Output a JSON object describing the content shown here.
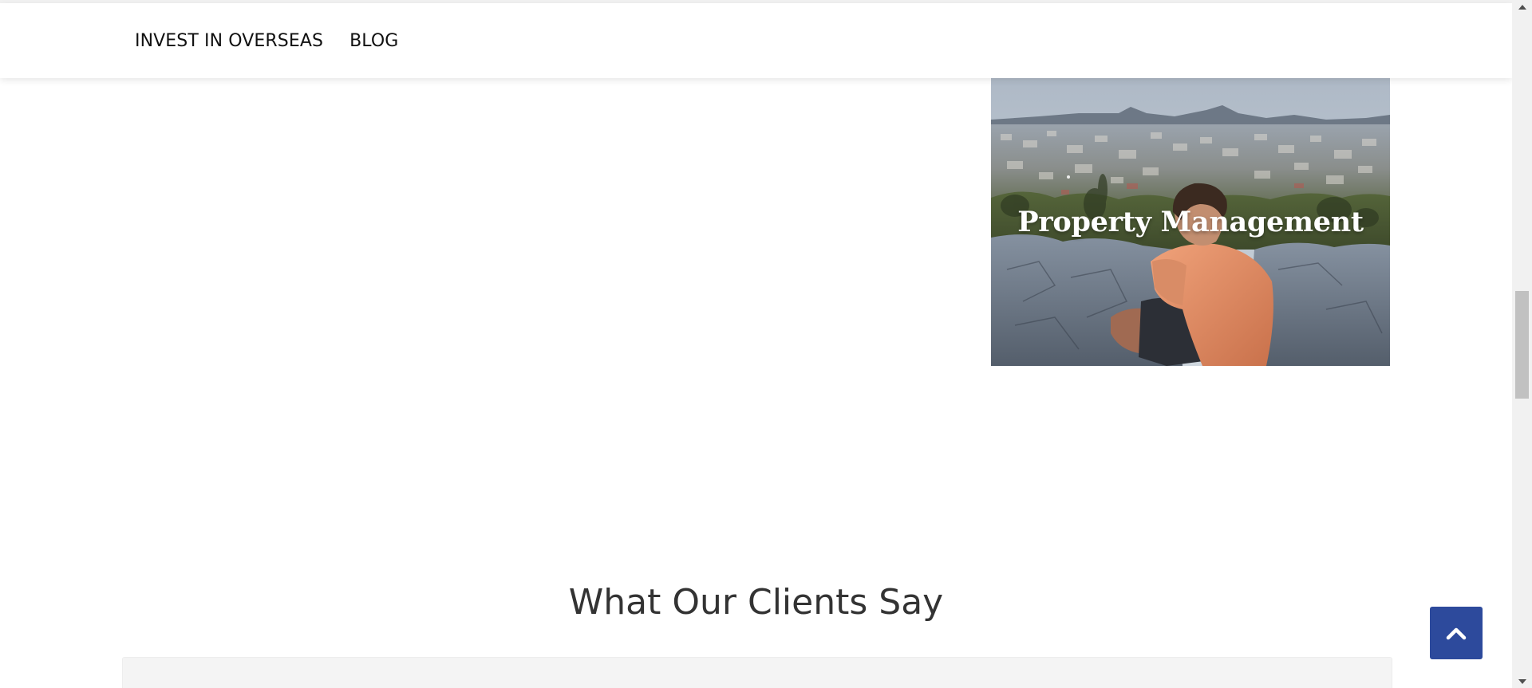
{
  "nav": {
    "items": [
      {
        "label": "INVEST IN OVERSEAS"
      },
      {
        "label": "BLOG"
      }
    ]
  },
  "service_card": {
    "title": "Property Management"
  },
  "testimonials": {
    "heading": "What Our Clients Say"
  },
  "back_to_top": {
    "icon": "chevron-up-icon"
  },
  "colors": {
    "accent": "#2d4a9c",
    "heading": "#333333",
    "panel": "#f4f4f4"
  }
}
